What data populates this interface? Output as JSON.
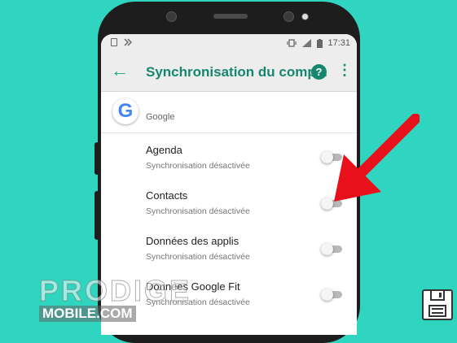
{
  "status_bar": {
    "time": "17:31",
    "left_icons": [
      "sim-icon",
      "notification-icon"
    ],
    "right_icons": [
      "vibrate-icon",
      "signal-icon",
      "battery-icon"
    ]
  },
  "toolbar": {
    "title": "Synchronisation du comp...",
    "back_icon": "arrow-back-icon",
    "help_label": "?",
    "more_label": "⋮"
  },
  "account": {
    "name": "Google",
    "logo_letter": "G",
    "logo_icon": "google-logo-icon"
  },
  "sync_items": [
    {
      "title": "Agenda",
      "status": "Synchronisation désactivée",
      "enabled": false
    },
    {
      "title": "Contacts",
      "status": "Synchronisation désactivée",
      "enabled": false
    },
    {
      "title": "Données des applis",
      "status": "Synchronisation désactivée",
      "enabled": false
    },
    {
      "title": "Données Google Fit",
      "status": "Synchronisation désactivée",
      "enabled": false
    }
  ],
  "watermark": {
    "line1": "PRODIGE",
    "line2": "MOBILE.COM"
  },
  "colors": {
    "background": "#2fd5bf",
    "accent": "#17866f",
    "arrow": "#e8101a"
  },
  "icons": {
    "arrow": "red-pointer-arrow-icon",
    "save": "floppy-disk-icon"
  }
}
